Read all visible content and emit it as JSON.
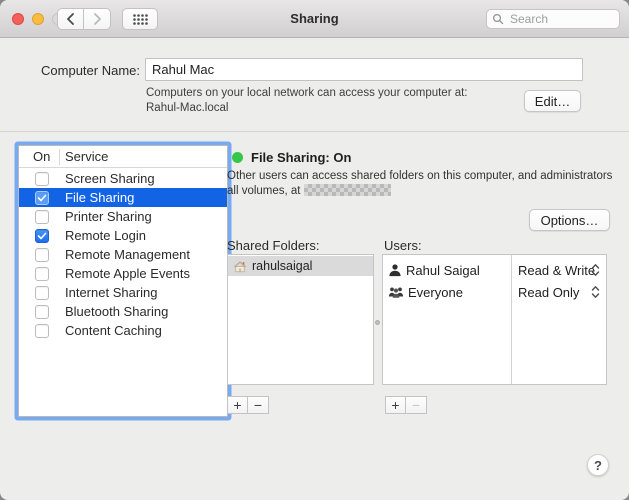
{
  "window": {
    "title": "Sharing",
    "search_placeholder": "Search"
  },
  "colors": {
    "selection_blue": "#1363e5",
    "focus_ring_blue": "#5a99f4",
    "checkbox_blue": "#2f80f2",
    "status_green": "#35c749"
  },
  "icons": {
    "back": "chevron-left",
    "forward": "chevron-right",
    "show_all": "grid-of-dots",
    "search": "magnifier",
    "status": "green-dot",
    "shared_folder": "home-folder",
    "user_single": "person-silhouette",
    "user_group": "group-silhouette",
    "permission_stepper": "up-down-chevrons"
  },
  "computer_name": {
    "label": "Computer Name:",
    "value": "Rahul Mac",
    "caption_line1": "Computers on your local network can access your computer at:",
    "caption_line2": "Rahul-Mac.local",
    "edit_button": "Edit…"
  },
  "services": {
    "columns": {
      "on": "On",
      "service": "Service"
    },
    "items": [
      {
        "label": "Screen Sharing",
        "checked": false,
        "selected": false
      },
      {
        "label": "File Sharing",
        "checked": true,
        "selected": true
      },
      {
        "label": "Printer Sharing",
        "checked": false,
        "selected": false
      },
      {
        "label": "Remote Login",
        "checked": true,
        "selected": false
      },
      {
        "label": "Remote Management",
        "checked": false,
        "selected": false
      },
      {
        "label": "Remote Apple Events",
        "checked": false,
        "selected": false
      },
      {
        "label": "Internet Sharing",
        "checked": false,
        "selected": false
      },
      {
        "label": "Bluetooth Sharing",
        "checked": false,
        "selected": false
      },
      {
        "label": "Content Caching",
        "checked": false,
        "selected": false
      }
    ]
  },
  "detail": {
    "status_title": "File Sharing: On",
    "description_line1": "Other users can access shared folders on this computer, and administrators",
    "description_line2_prefix": "all volumes, at",
    "description_redacted": true,
    "options_button": "Options…",
    "shared_folders": {
      "label": "Shared Folders:",
      "items": [
        {
          "name": "rahulsaigal",
          "selected": true
        }
      ]
    },
    "users": {
      "label": "Users:",
      "items": [
        {
          "name": "Rahul Saigal",
          "permission": "Read & Write",
          "icon": "person"
        },
        {
          "name": "Everyone",
          "permission": "Read Only",
          "icon": "group"
        }
      ]
    },
    "add_button": "+",
    "remove_button": "−"
  },
  "help_button": "?"
}
